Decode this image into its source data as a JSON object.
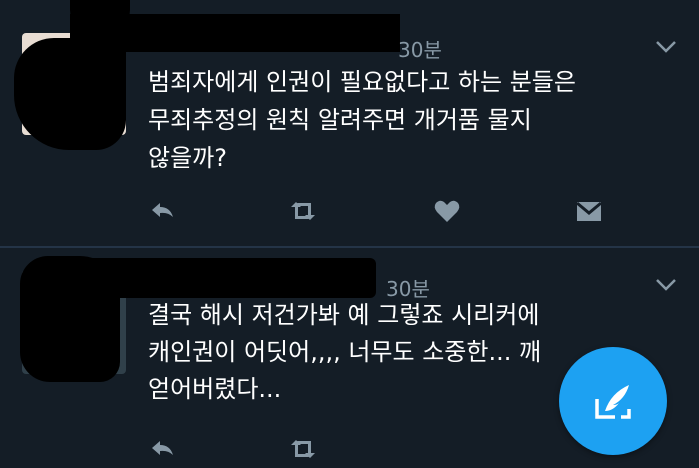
{
  "tweets": [
    {
      "time": "30분",
      "lines": [
        "범죄자에게 인권이 필요없다고 하는 분들은",
        "무죄추정의 원칙 알려주면 개거품 물지",
        "않을까?"
      ]
    },
    {
      "time": "30분",
      "lines": [
        "결국 해시 저건가봐 예 그렇죠 시리커에",
        "캐인권이 어딧어,,,, 너무도 소중한... 깨",
        "얻어버렸다..."
      ]
    }
  ],
  "icons": {
    "reply": "reply-icon",
    "retweet": "retweet-icon",
    "like": "heart-icon",
    "dm": "envelope-icon",
    "more": "chevron-down-icon",
    "compose": "compose-tweet-icon"
  },
  "colors": {
    "background": "#141d26",
    "secondary_text": "#8899a6",
    "accent": "#1da1f2"
  }
}
